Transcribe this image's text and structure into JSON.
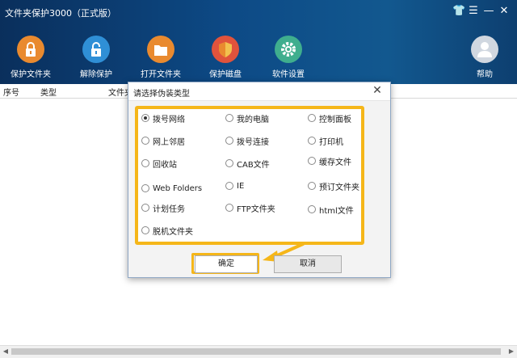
{
  "app": {
    "title": "文件夹保护3000（正式版）"
  },
  "window_controls": {
    "skin": "👕",
    "menu": "☰",
    "minimize": "—",
    "close": "✕"
  },
  "toolbar": [
    {
      "label": "保护文件夹",
      "icon": "lock-icon",
      "color": "#e98a2f"
    },
    {
      "label": "解除保护",
      "icon": "unlock-icon",
      "color": "#2f8fd6"
    },
    {
      "label": "打开文件夹",
      "icon": "folder-icon",
      "color": "#e98a2f"
    },
    {
      "label": "保护磁盘",
      "icon": "shield-icon",
      "color": "#e0533c"
    },
    {
      "label": "软件设置",
      "icon": "gear-icon",
      "color": "#3fae8e"
    },
    {
      "label": "帮助",
      "icon": "user-help-icon",
      "color": "#d0d7e0"
    }
  ],
  "table": {
    "columns": [
      "序号",
      "类型",
      "文件夹"
    ]
  },
  "dialog": {
    "title": "请选择伪装类型",
    "close": "✕",
    "options": [
      {
        "label": "拨号网络",
        "selected": true
      },
      {
        "label": "我的电脑",
        "selected": false
      },
      {
        "label": "控制面板",
        "selected": false
      },
      {
        "label": "网上邻居",
        "selected": false
      },
      {
        "label": "拨号连接",
        "selected": false
      },
      {
        "label": "打印机",
        "selected": false
      },
      {
        "label": "回收站",
        "selected": false
      },
      {
        "label": "CAB文件",
        "selected": false
      },
      {
        "label": "缓存文件",
        "selected": false
      },
      {
        "label": "Web Folders",
        "selected": false
      },
      {
        "label": "IE",
        "selected": false
      },
      {
        "label": "预订文件夹",
        "selected": false
      },
      {
        "label": "计划任务",
        "selected": false
      },
      {
        "label": "FTP文件夹",
        "selected": false
      },
      {
        "label": "html文件",
        "selected": false
      },
      {
        "label": "脱机文件夹",
        "selected": false
      }
    ],
    "ok_label": "确定",
    "cancel_label": "取消"
  },
  "colors": {
    "highlight": "#f5b619",
    "header": "#0d4a86"
  }
}
